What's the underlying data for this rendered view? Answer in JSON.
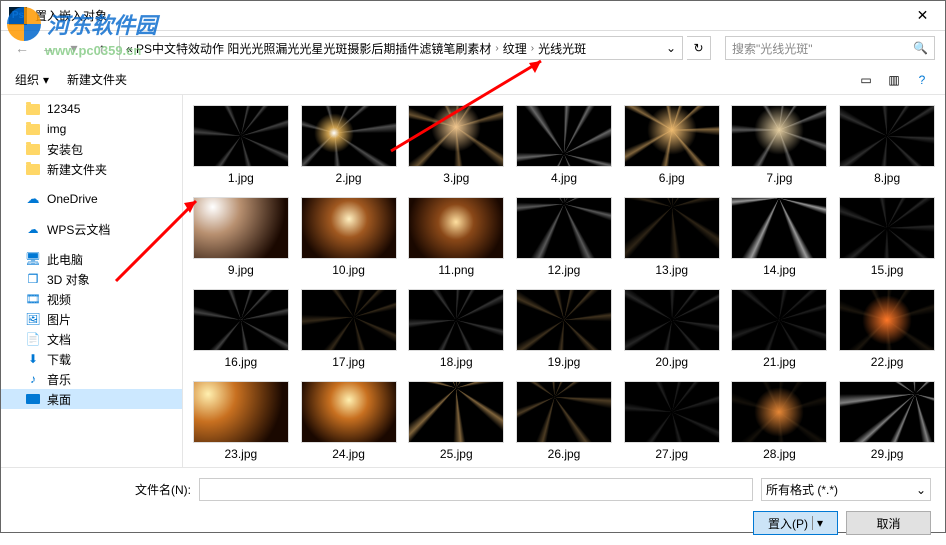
{
  "titlebar": {
    "title": "置入嵌入对象",
    "ps": "Ps"
  },
  "nav": {
    "breadcrumb_prefix": "« PS中文特效动作 阳光光照漏光光星光斑摄影后期插件滤镜笔刷素材",
    "crumb1": "纹理",
    "crumb2": "光线光斑",
    "search_placeholder": "搜索\"光线光斑\""
  },
  "toolbar": {
    "organize": "组织",
    "new_folder": "新建文件夹"
  },
  "sidebar": {
    "items": [
      {
        "label": "12345",
        "icon": "folder"
      },
      {
        "label": "img",
        "icon": "folder"
      },
      {
        "label": "安装包",
        "icon": "folder"
      },
      {
        "label": "新建文件夹",
        "icon": "folder"
      }
    ],
    "onedrive": "OneDrive",
    "wps": "WPS云文档",
    "thispc": "此电脑",
    "pc_items": [
      {
        "label": "3D 对象",
        "icon": "3d"
      },
      {
        "label": "视频",
        "icon": "video"
      },
      {
        "label": "图片",
        "icon": "pictures"
      },
      {
        "label": "文档",
        "icon": "docs"
      },
      {
        "label": "下载",
        "icon": "downloads"
      },
      {
        "label": "音乐",
        "icon": "music"
      },
      {
        "label": "桌面",
        "icon": "desktop"
      }
    ]
  },
  "thumbs": [
    {
      "name": "1.jpg",
      "cls": "light-rays",
      "cx": "50%",
      "cy": "50%",
      "ang": "10deg",
      "int": "0.25"
    },
    {
      "name": "2.jpg",
      "cls": "light-rays flare",
      "cx": "35%",
      "cy": "45%",
      "ang": "20deg",
      "int": "0.30"
    },
    {
      "name": "3.jpg",
      "cls": "light-rays warm glow",
      "cx": "50%",
      "cy": "35%",
      "ang": "0deg",
      "int": "0.40",
      "glow": "rgba(255,210,150,0.95)"
    },
    {
      "name": "4.jpg",
      "cls": "light-rays",
      "cx": "50%",
      "cy": "80%",
      "ang": "0deg",
      "int": "0.4"
    },
    {
      "name": "6.jpg",
      "cls": "light-rays warm glow",
      "cx": "50%",
      "cy": "40%",
      "ang": "15deg",
      "int": "0.5",
      "glow": "rgba(255,200,120,0.95)"
    },
    {
      "name": "7.jpg",
      "cls": "light-rays glow",
      "cx": "50%",
      "cy": "40%",
      "ang": "5deg",
      "int": "0.35"
    },
    {
      "name": "8.jpg",
      "cls": "light-rays",
      "cx": "50%",
      "cy": "50%",
      "ang": "30deg",
      "int": "0.18"
    },
    {
      "name": "9.jpg",
      "cls": "sunburst",
      "cx": "20%",
      "cy": "15%",
      "c1": "#fff",
      "c2": "#b89070"
    },
    {
      "name": "10.jpg",
      "cls": "sunburst",
      "cx": "50%",
      "cy": "35%",
      "c1": "#fff0c0",
      "c2": "#a05820"
    },
    {
      "name": "11.png",
      "cls": "sunburst",
      "cx": "50%",
      "cy": "40%",
      "c1": "#ffe0a0",
      "c2": "#8a4818"
    },
    {
      "name": "12.jpg",
      "cls": "light-rays",
      "cx": "50%",
      "cy": "10%",
      "ang": "0deg",
      "int": "0.35"
    },
    {
      "name": "13.jpg",
      "cls": "light-rays warm",
      "cx": "50%",
      "cy": "15%",
      "ang": "0deg",
      "int": "0.18"
    },
    {
      "name": "14.jpg",
      "cls": "light-rays",
      "cx": "50%",
      "cy": "0%",
      "ang": "0deg",
      "int": "0.6"
    },
    {
      "name": "15.jpg",
      "cls": "light-rays",
      "cx": "50%",
      "cy": "50%",
      "ang": "25deg",
      "int": "0.15"
    },
    {
      "name": "16.jpg",
      "cls": "light-rays",
      "cx": "50%",
      "cy": "50%",
      "ang": "15deg",
      "int": "0.25"
    },
    {
      "name": "17.jpg",
      "cls": "light-rays warm",
      "cx": "55%",
      "cy": "45%",
      "ang": "40deg",
      "int": "0.2"
    },
    {
      "name": "18.jpg",
      "cls": "light-rays",
      "cx": "50%",
      "cy": "50%",
      "ang": "0deg",
      "int": "0.2"
    },
    {
      "name": "19.jpg",
      "cls": "light-rays warm",
      "cx": "50%",
      "cy": "50%",
      "ang": "10deg",
      "int": "0.25"
    },
    {
      "name": "20.jpg",
      "cls": "light-rays",
      "cx": "50%",
      "cy": "50%",
      "ang": "35deg",
      "int": "0.15"
    },
    {
      "name": "21.jpg",
      "cls": "light-rays",
      "cx": "50%",
      "cy": "50%",
      "ang": "45deg",
      "int": "0.12"
    },
    {
      "name": "22.jpg",
      "cls": "light-rays warm glow",
      "cx": "50%",
      "cy": "50%",
      "ang": "0deg",
      "int": "0.1",
      "glow": "rgba(255,120,40,1)"
    },
    {
      "name": "23.jpg",
      "cls": "sunburst",
      "cx": "15%",
      "cy": "20%",
      "c1": "#fff0b0",
      "c2": "#c87020"
    },
    {
      "name": "24.jpg",
      "cls": "sunburst",
      "cx": "50%",
      "cy": "30%",
      "c1": "#fff0b0",
      "c2": "#c87020"
    },
    {
      "name": "25.jpg",
      "cls": "light-rays warm",
      "cx": "50%",
      "cy": "10%",
      "ang": "0deg",
      "int": "0.5"
    },
    {
      "name": "26.jpg",
      "cls": "light-rays warm",
      "cx": "40%",
      "cy": "25%",
      "ang": "20deg",
      "int": "0.3"
    },
    {
      "name": "27.jpg",
      "cls": "light-rays",
      "cx": "50%",
      "cy": "50%",
      "ang": "10deg",
      "int": "0.12"
    },
    {
      "name": "28.jpg",
      "cls": "light-rays warm glow",
      "cx": "50%",
      "cy": "50%",
      "ang": "0deg",
      "int": "0.08",
      "glow": "rgba(255,150,60,0.9)"
    },
    {
      "name": "29.jpg",
      "cls": "light-rays",
      "cx": "80%",
      "cy": "20%",
      "ang": "200deg",
      "int": "0.5"
    }
  ],
  "bottom": {
    "filename_label": "文件名(N):",
    "filetype": "所有格式 (*.*)",
    "place_btn": "置入(P)",
    "cancel_btn": "取消"
  },
  "watermark": {
    "brand": "河东软件园",
    "url": "www.pc0359.cn"
  }
}
